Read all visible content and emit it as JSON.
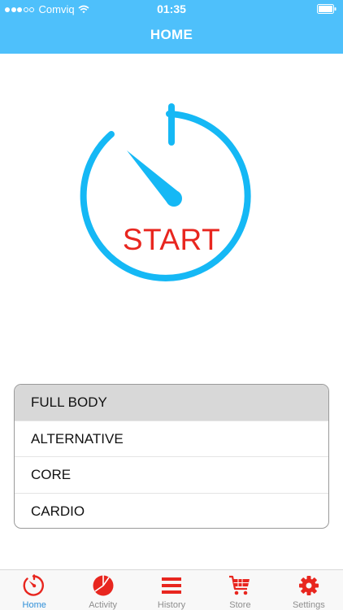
{
  "status_bar": {
    "carrier": "Comviq",
    "time": "01:35",
    "signal_bars_filled": 3,
    "signal_bars_total": 5
  },
  "header": {
    "title": "HOME",
    "background_color": "#4ec0fb"
  },
  "start_button": {
    "label": "START",
    "dial_color": "#15b8f5",
    "label_color": "#e8261f",
    "icon": "stopwatch-icon"
  },
  "workouts": {
    "selected_index": 0,
    "items": [
      {
        "label": "FULL BODY"
      },
      {
        "label": "ALTERNATIVE"
      },
      {
        "label": "CORE"
      },
      {
        "label": "CARDIO"
      }
    ]
  },
  "tab_bar": {
    "active_color": "#2f8fd9",
    "icon_color": "#e8261f",
    "tabs": [
      {
        "label": "Home",
        "icon": "stopwatch-icon",
        "active": true
      },
      {
        "label": "Activity",
        "icon": "pie-chart-icon",
        "active": false
      },
      {
        "label": "History",
        "icon": "list-icon",
        "active": false
      },
      {
        "label": "Store",
        "icon": "cart-icon",
        "active": false
      },
      {
        "label": "Settings",
        "icon": "gear-icon",
        "active": false
      }
    ]
  }
}
